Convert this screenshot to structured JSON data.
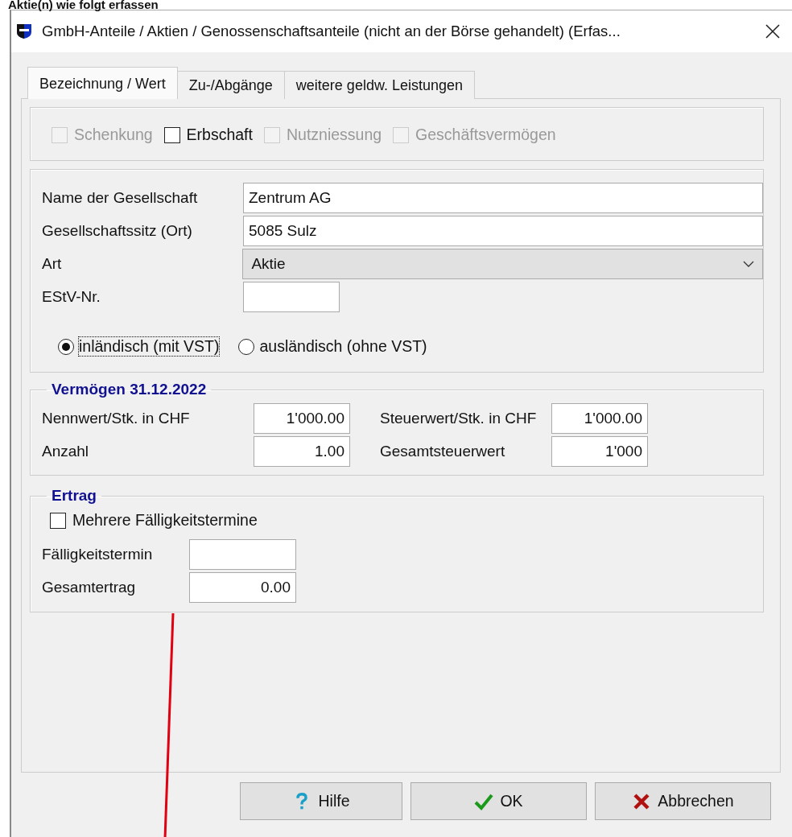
{
  "heading": "Aktie(n) wie folgt erfassen",
  "window": {
    "title": "GmbH-Anteile / Aktien / Genossenschaftsanteile (nicht an der Börse gehandelt) (Erfas..."
  },
  "tabs": [
    {
      "label": "Bezeichnung / Wert",
      "selected": true
    },
    {
      "label": "Zu-/Abgänge",
      "selected": false
    },
    {
      "label": "weitere geldw. Leistungen",
      "selected": false
    }
  ],
  "flags": [
    {
      "label": "Schenkung",
      "checked": false,
      "disabled": true
    },
    {
      "label": "Erbschaft",
      "checked": false,
      "disabled": false
    },
    {
      "label": "Nutzniessung",
      "checked": false,
      "disabled": true
    },
    {
      "label": "Geschäftsvermögen",
      "checked": false,
      "disabled": true
    }
  ],
  "fields": [
    {
      "label": "Name der Gesellschaft",
      "value": "Zentrum AG",
      "kind": "text"
    },
    {
      "label": "Gesellschaftssitz (Ort)",
      "value": "5085 Sulz",
      "kind": "text"
    },
    {
      "label": "Art",
      "value": "Aktie",
      "kind": "dropdown"
    },
    {
      "label": "EStV-Nr.",
      "kind": "short"
    }
  ],
  "origin": [
    {
      "label": "inländisch (mit VST)",
      "selected": true,
      "focused": true
    },
    {
      "label": "ausländisch (ohne VST)",
      "selected": false,
      "focused": false
    }
  ],
  "vermoegen": {
    "title": "Vermögen 31.12.2022",
    "fields": [
      {
        "label": "Nennwert/Stk. in CHF",
        "value": "1'000.00"
      },
      {
        "label": "Steuerwert/Stk. in CHF",
        "value": "1'000.00"
      },
      {
        "label": "Anzahl",
        "value": "1.00"
      },
      {
        "label": "Gesamtsteuerwert",
        "value": "1'000"
      }
    ]
  },
  "ertrag": {
    "title": "Ertrag",
    "multiple": {
      "label": "Mehrere Fälligkeitstermine",
      "checked": false
    },
    "fields": [
      {
        "label": "Fälligkeitstermin"
      },
      {
        "label": "Gesamtertrag",
        "value": "0.00"
      }
    ]
  },
  "buttons": [
    {
      "label": "Hilfe",
      "kind": "help"
    },
    {
      "label": "OK",
      "kind": "ok"
    },
    {
      "label": "Abbrechen",
      "kind": "cancel"
    }
  ]
}
